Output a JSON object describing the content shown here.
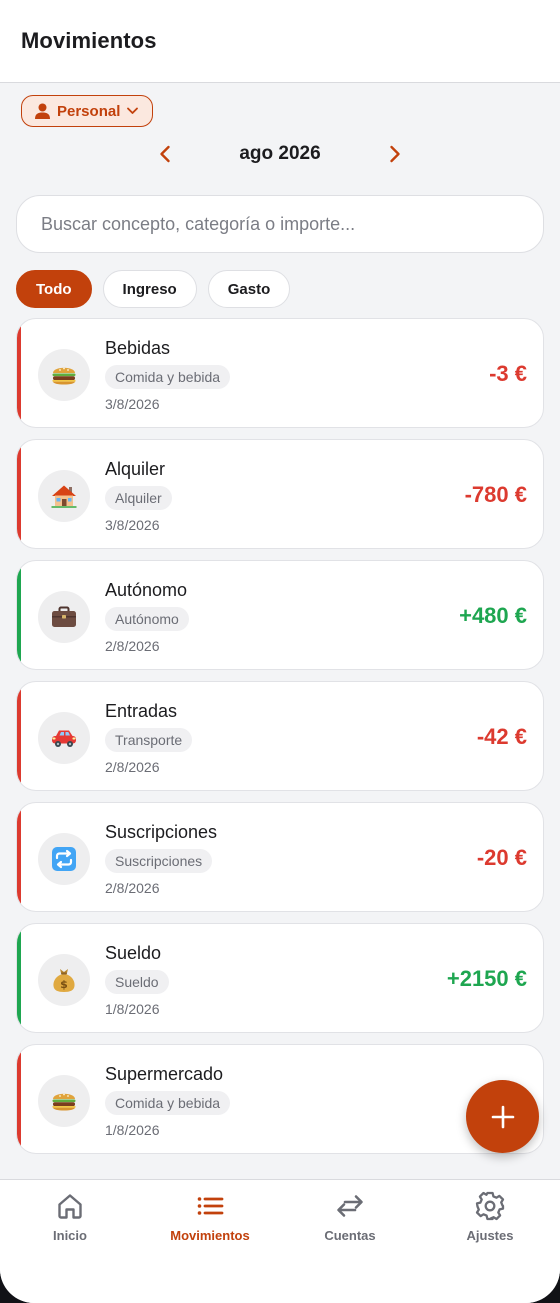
{
  "app": {
    "title": "Movimientos"
  },
  "account": {
    "name": "Personal"
  },
  "month": {
    "label": "ago 2026"
  },
  "search": {
    "placeholder": "Buscar concepto, categoría o importe..."
  },
  "filters": [
    {
      "label": "Todo",
      "active": true
    },
    {
      "label": "Ingreso",
      "active": false
    },
    {
      "label": "Gasto",
      "active": false
    }
  ],
  "transactions": [
    {
      "title": "Bebidas",
      "category": "Comida y bebida",
      "date": "3/8/2026",
      "amount": "-3 €",
      "type": "expense",
      "icon": "burger-icon"
    },
    {
      "title": "Alquiler",
      "category": "Alquiler",
      "date": "3/8/2026",
      "amount": "-780 €",
      "type": "expense",
      "icon": "house-icon"
    },
    {
      "title": "Autónomo",
      "category": "Autónomo",
      "date": "2/8/2026",
      "amount": "+480 €",
      "type": "income",
      "icon": "briefcase-icon"
    },
    {
      "title": "Entradas",
      "category": "Transporte",
      "date": "2/8/2026",
      "amount": "-42 €",
      "type": "expense",
      "icon": "car-icon"
    },
    {
      "title": "Suscripciones",
      "category": "Suscripciones",
      "date": "2/8/2026",
      "amount": "-20 €",
      "type": "expense",
      "icon": "repeat-icon"
    },
    {
      "title": "Sueldo",
      "category": "Sueldo",
      "date": "1/8/2026",
      "amount": "+2150 €",
      "type": "income",
      "icon": "money-bag-icon"
    },
    {
      "title": "Supermercado",
      "category": "Comida y bebida",
      "date": "1/8/2026",
      "amount": "-",
      "type": "expense",
      "icon": "burger-icon"
    }
  ],
  "nav": [
    {
      "label": "Inicio",
      "icon": "home-icon",
      "active": false
    },
    {
      "label": "Movimientos",
      "icon": "list-icon",
      "active": true
    },
    {
      "label": "Cuentas",
      "icon": "transfer-icon",
      "active": false
    },
    {
      "label": "Ajustes",
      "icon": "gear-icon",
      "active": false
    }
  ],
  "colors": {
    "accent": "#c2410c",
    "expense": "#dc3a2f",
    "income": "#1ea650"
  }
}
